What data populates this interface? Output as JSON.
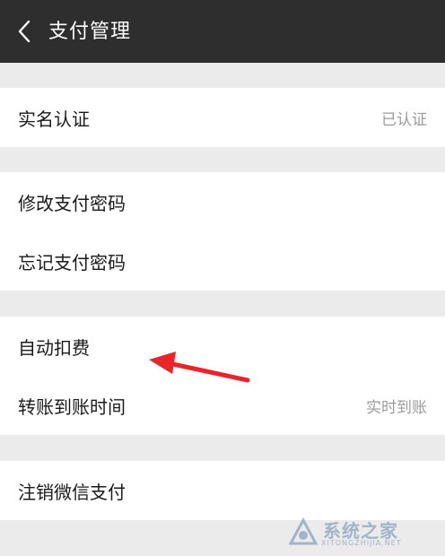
{
  "header": {
    "title": "支付管理",
    "back_icon": "chevron-left-icon"
  },
  "groups": [
    {
      "rows": [
        {
          "label": "实名认证",
          "value": "已认证"
        }
      ]
    },
    {
      "rows": [
        {
          "label": "修改支付密码",
          "value": ""
        },
        {
          "label": "忘记支付密码",
          "value": ""
        }
      ]
    },
    {
      "rows": [
        {
          "label": "自动扣费",
          "value": ""
        },
        {
          "label": "转账到账时间",
          "value": "实时到账"
        }
      ]
    },
    {
      "rows": [
        {
          "label": "注销微信支付",
          "value": ""
        }
      ]
    }
  ],
  "annotation": {
    "color": "#e8262a",
    "target": "自动扣费"
  },
  "watermark": {
    "text": "系统之家",
    "sub": "XITONGZHIJIA.NET"
  },
  "colors": {
    "header_bg": "#2e2e2e",
    "page_bg": "#ebebeb",
    "row_bg": "#ffffff",
    "secondary_text": "#9b9b9b"
  }
}
